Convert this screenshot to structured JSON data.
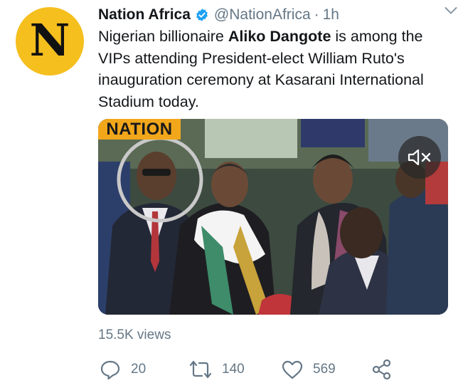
{
  "tweet": {
    "avatar_letter": "N",
    "author_name": "Nation Africa",
    "handle": "@NationAfrica",
    "separator": "·",
    "time": "1h",
    "text_parts": [
      "Nigerian billionaire ",
      "Aliko Dangote",
      " is among the VIPs attending President-elect  William Ruto's inauguration ceremony at Kasarani International Stadium today."
    ],
    "media_badge": "NATION",
    "views": "15.5K views",
    "replies": "20",
    "retweets": "140",
    "likes": "569"
  },
  "colors": {
    "avatar_bg": "#f5bf1e",
    "verified_blue": "#1da1f2",
    "secondary_text": "#657786",
    "badge_bg": "#f2a71b"
  },
  "icons": [
    "verified-badge-icon",
    "chevron-down-icon",
    "mute-icon",
    "reply-icon",
    "retweet-icon",
    "like-icon",
    "share-icon"
  ]
}
